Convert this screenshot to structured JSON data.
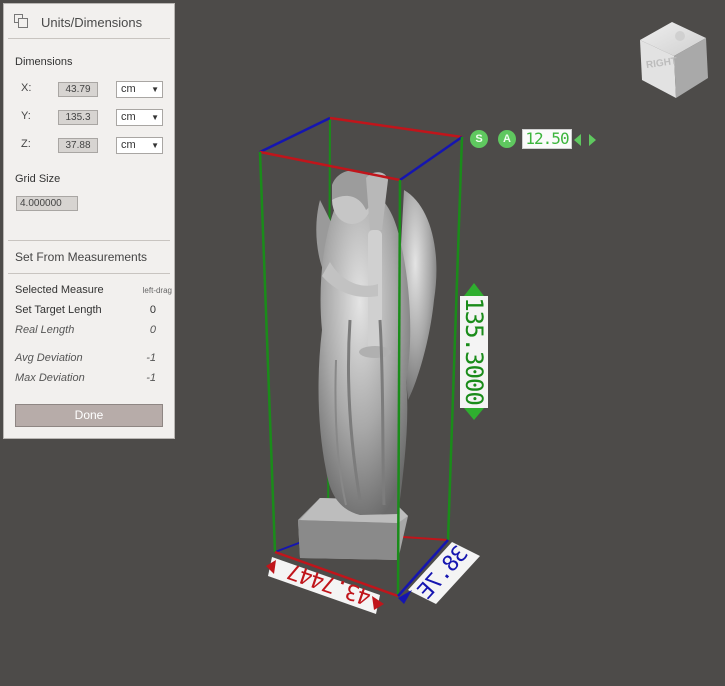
{
  "panel": {
    "title": "Units/Dimensions",
    "dimensions_label": "Dimensions",
    "x_label": "X:",
    "x_value": "43.79",
    "x_unit": "cm",
    "y_label": "Y:",
    "y_value": "135.3",
    "y_unit": "cm",
    "z_label": "Z:",
    "z_value": "37.88",
    "z_unit": "cm",
    "grid_size_label": "Grid Size",
    "grid_size_value": "4.000000",
    "set_from_label": "Set From Measurements",
    "selected_measure_label": "Selected Measure",
    "selected_measure_value": "left-drag",
    "set_target_length_label": "Set Target Length",
    "set_target_length_value": "0",
    "real_length_label": "Real Length",
    "real_length_value": "0",
    "avg_deviation_label": "Avg Deviation",
    "avg_deviation_value": "-1",
    "max_deviation_label": "Max Deviation",
    "max_deviation_value": "-1",
    "done_label": "Done"
  },
  "viewcube": {
    "face_label": "RIGHT"
  },
  "scale_control": {
    "s_label": "S",
    "a_label": "A",
    "value": "12.50"
  },
  "measure_labels": {
    "height": "135.3000",
    "width": "43.7447",
    "depth": "38.7E"
  },
  "colors": {
    "background": "#4d4b49",
    "x_axis": "#c0151b",
    "y_axis": "#1a8c1a",
    "z_axis": "#1515b0",
    "accent_green": "#5fc85f"
  },
  "icons": {
    "panel_icon": "window-stack-icon",
    "viewcube": "viewcube-icon"
  }
}
